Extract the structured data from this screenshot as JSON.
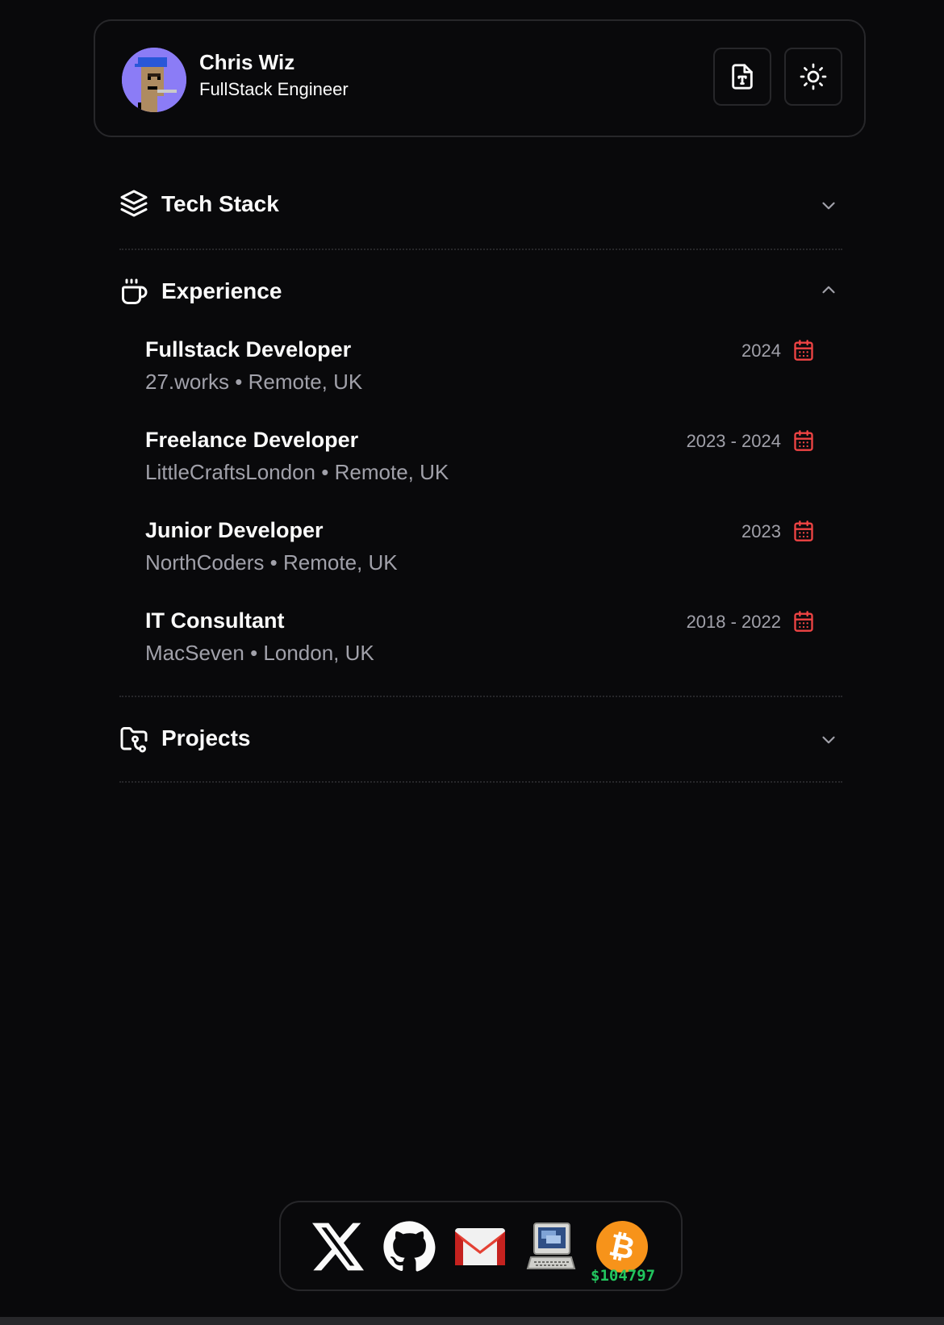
{
  "profile": {
    "name": "Chris Wiz",
    "role": "FullStack Engineer"
  },
  "header_buttons": {
    "resume_icon": "file-type-icon",
    "theme_icon": "sun-icon"
  },
  "sections": {
    "tech_stack": {
      "title": "Tech Stack",
      "icon": "layers-icon",
      "expanded": false
    },
    "experience": {
      "title": "Experience",
      "icon": "coffee-icon",
      "expanded": true
    },
    "projects": {
      "title": "Projects",
      "icon": "folder-git-icon",
      "expanded": false
    }
  },
  "experience": [
    {
      "title": "Fullstack Developer",
      "company": "27.works",
      "location": "Remote, UK",
      "dates": "2024"
    },
    {
      "title": "Freelance Developer",
      "company": "LittleCraftsLondon",
      "location": "Remote, UK",
      "dates": "2023 - 2024"
    },
    {
      "title": "Junior Developer",
      "company": "NorthCoders",
      "location": "Remote, UK",
      "dates": "2023"
    },
    {
      "title": "IT Consultant",
      "company": "MacSeven",
      "location": "London, UK",
      "dates": "2018 - 2022"
    }
  ],
  "separator": "•",
  "dock": {
    "items": [
      "x-icon",
      "github-icon",
      "gmail-icon",
      "computer-icon",
      "bitcoin-icon"
    ],
    "btc_price": "$104797"
  },
  "colors": {
    "background": "#09090b",
    "border": "#27272a",
    "muted_text": "#a1a1aa",
    "calendar_accent": "#ef4444",
    "btc_orange": "#f7931a",
    "btc_price_green": "#22c55e",
    "avatar_bg": "#8b7cf6"
  }
}
